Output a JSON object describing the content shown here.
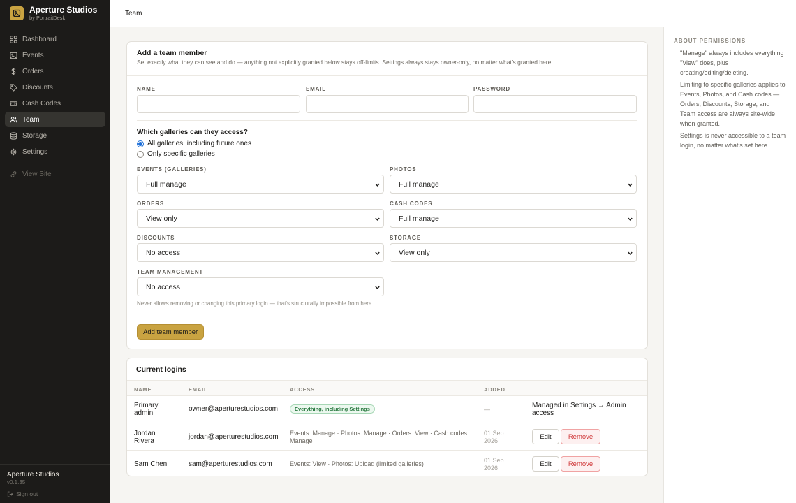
{
  "brand": {
    "title": "Aperture Studios",
    "subtitle": "by PortraitDesk",
    "icon": "image-icon"
  },
  "sidebar": {
    "items": [
      {
        "label": "Dashboard",
        "icon": "grid-icon"
      },
      {
        "label": "Events",
        "icon": "image-icon"
      },
      {
        "label": "Orders",
        "icon": "dollar-icon"
      },
      {
        "label": "Discounts",
        "icon": "tag-icon"
      },
      {
        "label": "Cash Codes",
        "icon": "ticket-icon"
      },
      {
        "label": "Team",
        "icon": "users-icon",
        "active": true
      },
      {
        "label": "Storage",
        "icon": "database-icon"
      },
      {
        "label": "Settings",
        "icon": "gear-icon"
      }
    ],
    "view_site": "View Site"
  },
  "footer": {
    "name": "Aperture Studios",
    "version": "v0.1.35",
    "sign_out": "Sign out"
  },
  "header": {
    "title": "Team"
  },
  "form": {
    "title": "Add a team member",
    "subtitle": "Set exactly what they can see and do — anything not explicitly granted below stays off-limits. Settings always stays owner-only, no matter what's granted here.",
    "name_label": "NAME",
    "email_label": "EMAIL",
    "password_label": "PASSWORD",
    "name_value": "",
    "email_value": "",
    "password_value": "",
    "galleries_question": "Which galleries can they access?",
    "gallery_options": [
      {
        "label": "All galleries, including future ones",
        "selected": true
      },
      {
        "label": "Only specific galleries",
        "selected": false
      }
    ],
    "permissions": {
      "events": {
        "label": "EVENTS (GALLERIES)",
        "value": "Full manage"
      },
      "photos": {
        "label": "PHOTOS",
        "value": "Full manage"
      },
      "orders": {
        "label": "ORDERS",
        "value": "View only"
      },
      "cash_codes": {
        "label": "CASH CODES",
        "value": "Full manage"
      },
      "discounts": {
        "label": "DISCOUNTS",
        "value": "No access"
      },
      "storage": {
        "label": "STORAGE",
        "value": "View only"
      },
      "team": {
        "label": "TEAM MANAGEMENT",
        "value": "No access"
      }
    },
    "team_hint": "Never allows removing or changing this primary login — that's structurally impossible from here.",
    "submit": "Add team member"
  },
  "logins": {
    "title": "Current logins",
    "columns": [
      "NAME",
      "EMAIL",
      "ACCESS",
      "ADDED"
    ],
    "rows": [
      {
        "name": "Primary admin",
        "email": "owner@aperturestudios.com",
        "access": "Everything, including Settings",
        "added": "—",
        "action_text": "Managed in Settings → Admin access"
      },
      {
        "name": "Jordan Rivera",
        "email": "jordan@aperturestudios.com",
        "access": "Events: Manage · Photos: Manage · Orders: View · Cash codes: Manage",
        "added": "01 Sep 2026",
        "edit": "Edit",
        "remove": "Remove"
      },
      {
        "name": "Sam Chen",
        "email": "sam@aperturestudios.com",
        "access": "Events: View · Photos: Upload (limited galleries)",
        "added": "01 Sep 2026",
        "edit": "Edit",
        "remove": "Remove"
      }
    ]
  },
  "about": {
    "title": "ABOUT PERMISSIONS",
    "items": [
      "\"Manage\" always includes everything \"View\" does, plus creating/editing/deleting.",
      "Limiting to specific galleries applies to Events, Photos, and Cash codes — Orders, Discounts, Storage, and Team access are always site-wide when granted.",
      "Settings is never accessible to a team login, no matter what's set here."
    ]
  },
  "colors": {
    "sidebar_bg": "#1c1b19",
    "accent": "#c9a341",
    "danger": "#d0393a",
    "success": "#2a7a41"
  }
}
